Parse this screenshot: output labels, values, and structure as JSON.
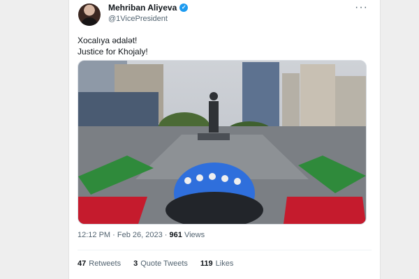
{
  "tweet": {
    "author_name": "Mehriban Aliyeva",
    "author_handle": "@1VicePresident",
    "text_line_1": "Xocalıya ədalət!",
    "text_line_2": "Justice for Khojaly!",
    "time": "12:12 PM",
    "separator": "·",
    "date": "Feb 26, 2023",
    "separator_2": "·",
    "views_count": "961",
    "views_label": "Views",
    "retweets_count": "47",
    "retweets_label": "Retweets",
    "quotes_count": "3",
    "quotes_label": "Quote Tweets",
    "likes_count": "119",
    "likes_label": "Likes",
    "more_label": "···"
  },
  "icons": {
    "verified": "verified-badge-icon",
    "more": "more-options-icon"
  },
  "colors": {
    "verified_blue": "#1d9bf0",
    "text_primary": "#0f1419",
    "text_secondary": "#536471",
    "carpet_red": "#c51b2d",
    "crowd_blue": "#2f6fdc"
  }
}
